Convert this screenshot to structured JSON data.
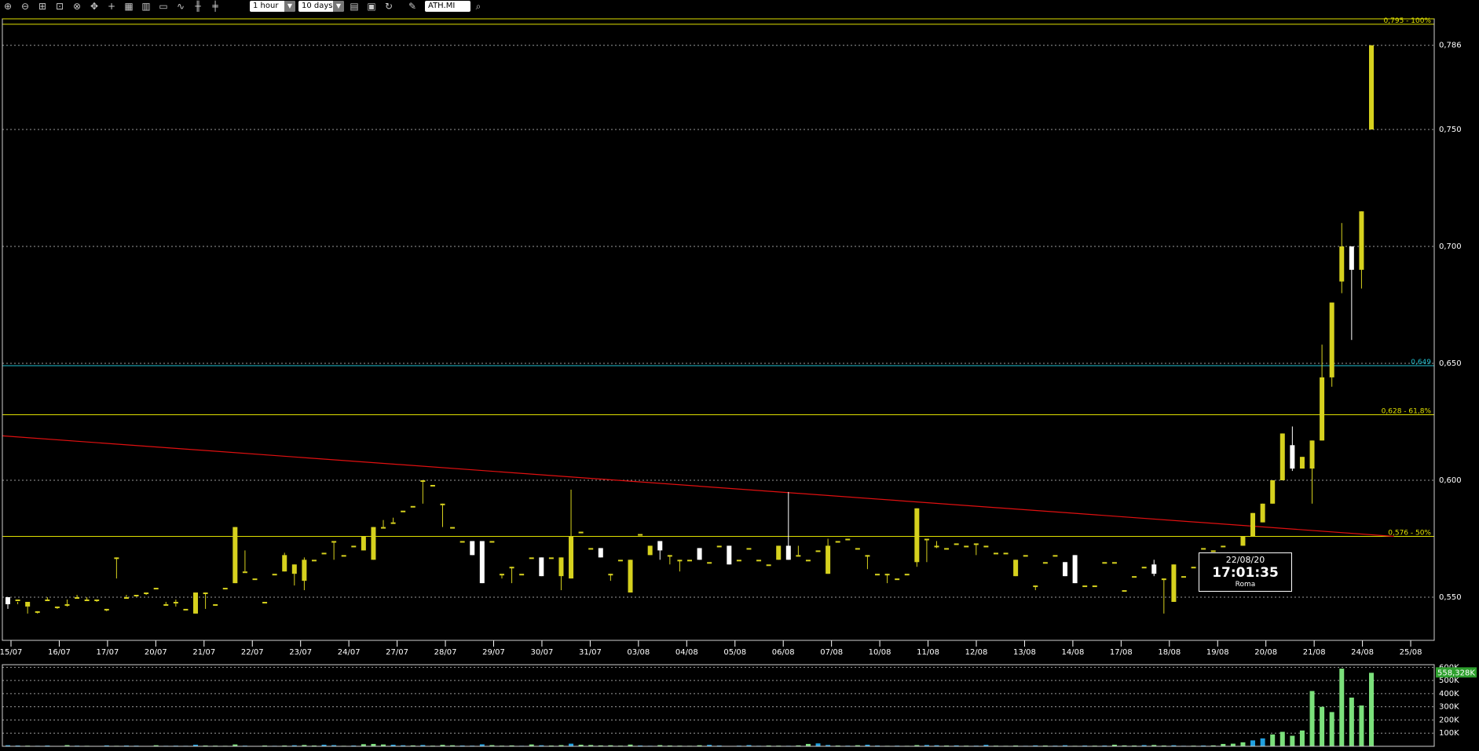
{
  "toolbar": {
    "icons": [
      "zoom-in-icon",
      "zoom-out-icon",
      "zoom-fit-icon",
      "zoom-region-icon",
      "zoom-reset-icon",
      "move-icon",
      "crosshair-icon",
      "table-view-icon",
      "grid-icon",
      "window-icon",
      "line-chart-icon",
      "candle-chart-icon",
      "bar-chart-icon"
    ],
    "timeframe": "1 hour",
    "period": "10 days",
    "symbol": "ATH.MI"
  },
  "colors": {
    "up": "#d6d11e",
    "down": "#ffffff",
    "fib": "#e0e000",
    "cyan": "#20c0d0",
    "trend": "#e01010",
    "grid": "#9a9a9a",
    "volume_up": "#7be07b",
    "volume_down": "#20a0e0"
  },
  "chart_data": [
    {
      "type": "candlestick",
      "timeframe": "1 hour",
      "ylim": [
        0.535,
        0.797
      ],
      "y_ticks": [
        "0,550",
        "0,600",
        "0,650",
        "0,700",
        "0,750",
        "0,786"
      ],
      "x_ticks": [
        "15/07",
        "16/07",
        "17/07",
        "20/07",
        "21/07",
        "22/07",
        "23/07",
        "24/07",
        "27/07",
        "28/07",
        "29/07",
        "30/07",
        "31/07",
        "03/08",
        "04/08",
        "05/08",
        "06/08",
        "07/08",
        "10/08",
        "11/08",
        "12/08",
        "13/08",
        "14/08",
        "17/08",
        "18/08",
        "19/08",
        "20/08",
        "21/08",
        "24/08",
        "25/08"
      ],
      "annotations": [
        {
          "label": "0,795 - 100%",
          "value": 0.795,
          "color": "#e0e000"
        },
        {
          "label": "0,649",
          "value": 0.649,
          "color": "#20c0d0"
        },
        {
          "label": "0,628 - 61,8%",
          "value": 0.628,
          "color": "#e0e000"
        },
        {
          "label": "0,576 - 50%",
          "value": 0.576,
          "color": "#e0e000"
        }
      ],
      "trendline": {
        "from": [
          "15/07",
          0.619
        ],
        "to": [
          "24/08",
          0.576
        ]
      },
      "candles": [
        [
          0.55,
          0.547,
          0.549,
          0.545
        ],
        [
          0.549,
          0.549,
          0.547,
          0.548
        ],
        [
          0.546,
          0.548,
          0.546,
          0.543
        ],
        [
          0.544,
          0.544,
          0.544,
          0.543
        ],
        [
          0.549,
          0.549,
          0.55,
          0.549
        ],
        [
          0.546,
          0.546,
          0.546,
          0.545
        ],
        [
          0.547,
          0.547,
          0.549,
          0.546
        ],
        [
          0.55,
          0.55,
          0.551,
          0.55
        ],
        [
          0.549,
          0.549,
          0.55,
          0.549
        ],
        [
          0.549,
          0.549,
          0.549,
          0.548
        ],
        [
          0.545,
          0.545,
          0.545,
          0.544
        ],
        [
          0.567,
          0.567,
          0.567,
          0.558
        ],
        [
          0.55,
          0.55,
          0.551,
          0.55
        ],
        [
          0.551,
          0.551,
          0.551,
          0.551
        ],
        [
          0.552,
          0.552,
          0.552,
          0.551
        ],
        [
          0.554,
          0.554,
          0.554,
          0.554
        ],
        [
          0.547,
          0.547,
          0.548,
          0.547
        ],
        [
          0.548,
          0.548,
          0.549,
          0.546
        ],
        [
          0.545,
          0.545,
          0.545,
          0.545
        ],
        [
          0.543,
          0.552,
          0.552,
          0.543
        ],
        [
          0.552,
          0.552,
          0.552,
          0.545
        ],
        [
          0.547,
          0.547,
          0.547,
          0.547
        ],
        [
          0.554,
          0.554,
          0.554,
          0.554
        ],
        [
          0.556,
          0.58,
          0.58,
          0.556
        ],
        [
          0.561,
          0.561,
          0.57,
          0.561
        ],
        [
          0.558,
          0.558,
          0.558,
          0.558
        ],
        [
          0.548,
          0.548,
          0.548,
          0.548
        ],
        [
          0.56,
          0.56,
          0.56,
          0.56
        ],
        [
          0.561,
          0.568,
          0.569,
          0.561
        ],
        [
          0.56,
          0.564,
          0.564,
          0.555
        ],
        [
          0.557,
          0.566,
          0.567,
          0.553
        ],
        [
          0.566,
          0.566,
          0.566,
          0.566
        ],
        [
          0.569,
          0.569,
          0.569,
          0.569
        ],
        [
          0.574,
          0.574,
          0.574,
          0.566
        ],
        [
          0.568,
          0.568,
          0.568,
          0.568
        ],
        [
          0.572,
          0.572,
          0.572,
          0.572
        ],
        [
          0.57,
          0.576,
          0.576,
          0.57
        ],
        [
          0.566,
          0.58,
          0.58,
          0.566
        ],
        [
          0.58,
          0.58,
          0.583,
          0.58
        ],
        [
          0.582,
          0.582,
          0.584,
          0.582
        ],
        [
          0.587,
          0.587,
          0.587,
          0.587
        ],
        [
          0.589,
          0.589,
          0.589,
          0.589
        ],
        [
          0.6,
          0.6,
          0.6,
          0.59
        ],
        [
          0.598,
          0.598,
          0.598,
          0.598
        ],
        [
          0.59,
          0.59,
          0.59,
          0.58
        ],
        [
          0.58,
          0.58,
          0.58,
          0.58
        ],
        [
          0.574,
          0.574,
          0.574,
          0.574
        ],
        [
          0.574,
          0.568,
          0.574,
          0.568
        ],
        [
          0.574,
          0.556,
          0.574,
          0.556
        ],
        [
          0.574,
          0.574,
          0.574,
          0.574
        ],
        [
          0.56,
          0.56,
          0.56,
          0.558
        ],
        [
          0.563,
          0.563,
          0.563,
          0.556
        ],
        [
          0.56,
          0.56,
          0.56,
          0.56
        ],
        [
          0.567,
          0.567,
          0.567,
          0.567
        ],
        [
          0.567,
          0.559,
          0.567,
          0.559
        ],
        [
          0.567,
          0.567,
          0.567,
          0.567
        ],
        [
          0.559,
          0.567,
          0.567,
          0.553
        ],
        [
          0.558,
          0.576,
          0.596,
          0.558
        ],
        [
          0.578,
          0.578,
          0.578,
          0.578
        ],
        [
          0.571,
          0.571,
          0.571,
          0.571
        ],
        [
          0.571,
          0.567,
          0.571,
          0.567
        ],
        [
          0.56,
          0.56,
          0.56,
          0.557
        ],
        [
          0.566,
          0.566,
          0.566,
          0.566
        ],
        [
          0.552,
          0.566,
          0.566,
          0.552
        ],
        [
          0.577,
          0.577,
          0.577,
          0.577
        ],
        [
          0.568,
          0.572,
          0.572,
          0.568
        ],
        [
          0.574,
          0.57,
          0.574,
          0.566
        ],
        [
          0.568,
          0.568,
          0.568,
          0.564
        ],
        [
          0.566,
          0.566,
          0.566,
          0.561
        ],
        [
          0.566,
          0.566,
          0.566,
          0.566
        ],
        [
          0.571,
          0.566,
          0.571,
          0.566
        ],
        [
          0.565,
          0.565,
          0.565,
          0.565
        ],
        [
          0.572,
          0.572,
          0.572,
          0.572
        ],
        [
          0.572,
          0.564,
          0.572,
          0.564
        ],
        [
          0.566,
          0.566,
          0.566,
          0.566
        ],
        [
          0.571,
          0.571,
          0.571,
          0.571
        ],
        [
          0.566,
          0.566,
          0.566,
          0.566
        ],
        [
          0.564,
          0.564,
          0.564,
          0.564
        ],
        [
          0.566,
          0.572,
          0.572,
          0.566
        ],
        [
          0.572,
          0.566,
          0.595,
          0.566
        ],
        [
          0.568,
          0.568,
          0.572,
          0.568
        ],
        [
          0.566,
          0.566,
          0.566,
          0.566
        ],
        [
          0.57,
          0.57,
          0.57,
          0.57
        ],
        [
          0.56,
          0.572,
          0.575,
          0.56
        ],
        [
          0.574,
          0.574,
          0.574,
          0.574
        ],
        [
          0.575,
          0.575,
          0.575,
          0.575
        ],
        [
          0.571,
          0.571,
          0.571,
          0.571
        ],
        [
          0.568,
          0.568,
          0.568,
          0.562
        ],
        [
          0.56,
          0.56,
          0.56,
          0.56
        ],
        [
          0.56,
          0.56,
          0.56,
          0.556
        ],
        [
          0.558,
          0.558,
          0.558,
          0.558
        ],
        [
          0.56,
          0.56,
          0.56,
          0.56
        ],
        [
          0.565,
          0.588,
          0.588,
          0.563
        ],
        [
          0.575,
          0.575,
          0.575,
          0.565
        ],
        [
          0.572,
          0.572,
          0.574,
          0.571
        ],
        [
          0.571,
          0.571,
          0.571,
          0.571
        ],
        [
          0.573,
          0.573,
          0.573,
          0.573
        ],
        [
          0.572,
          0.572,
          0.572,
          0.572
        ],
        [
          0.573,
          0.573,
          0.573,
          0.568
        ],
        [
          0.572,
          0.572,
          0.572,
          0.572
        ],
        [
          0.569,
          0.569,
          0.569,
          0.569
        ],
        [
          0.569,
          0.569,
          0.569,
          0.569
        ],
        [
          0.559,
          0.566,
          0.566,
          0.559
        ],
        [
          0.568,
          0.568,
          0.568,
          0.568
        ],
        [
          0.555,
          0.555,
          0.555,
          0.553
        ],
        [
          0.565,
          0.565,
          0.565,
          0.565
        ],
        [
          0.568,
          0.568,
          0.568,
          0.568
        ],
        [
          0.565,
          0.559,
          0.565,
          0.559
        ],
        [
          0.568,
          0.556,
          0.568,
          0.556
        ],
        [
          0.555,
          0.555,
          0.555,
          0.555
        ],
        [
          0.555,
          0.555,
          0.555,
          0.555
        ],
        [
          0.565,
          0.565,
          0.565,
          0.565
        ],
        [
          0.565,
          0.565,
          0.565,
          0.565
        ],
        [
          0.553,
          0.553,
          0.553,
          0.553
        ],
        [
          0.559,
          0.559,
          0.559,
          0.559
        ],
        [
          0.563,
          0.563,
          0.563,
          0.563
        ],
        [
          0.564,
          0.56,
          0.566,
          0.559
        ],
        [
          0.558,
          0.558,
          0.558,
          0.543
        ],
        [
          0.548,
          0.564,
          0.564,
          0.548
        ],
        [
          0.559,
          0.559,
          0.559,
          0.559
        ],
        [
          0.563,
          0.563,
          0.563,
          0.563
        ],
        [
          0.571,
          0.571,
          0.571,
          0.571
        ],
        [
          0.57,
          0.57,
          0.57,
          0.57
        ],
        [
          0.572,
          0.572,
          0.572,
          0.572
        ],
        [
          0.569,
          0.569,
          0.569,
          0.569
        ],
        [
          0.572,
          0.576,
          0.576,
          0.572
        ],
        [
          0.576,
          0.586,
          0.586,
          0.576
        ],
        [
          0.582,
          0.59,
          0.59,
          0.582
        ],
        [
          0.59,
          0.6,
          0.6,
          0.59
        ],
        [
          0.6,
          0.62,
          0.62,
          0.6
        ],
        [
          0.615,
          0.605,
          0.623,
          0.604
        ],
        [
          0.605,
          0.61,
          0.61,
          0.605
        ],
        [
          0.605,
          0.617,
          0.617,
          0.59
        ],
        [
          0.617,
          0.644,
          0.658,
          0.617
        ],
        [
          0.644,
          0.676,
          0.676,
          0.64
        ],
        [
          0.685,
          0.7,
          0.71,
          0.68
        ],
        [
          0.7,
          0.69,
          0.7,
          0.66
        ],
        [
          0.69,
          0.715,
          0.715,
          0.682
        ],
        [
          0.75,
          0.786,
          0.786,
          0.75
        ]
      ]
    },
    {
      "type": "bar",
      "title": "",
      "y_ticks": [
        "100K",
        "200K",
        "300K",
        "400K",
        "500K",
        "600K"
      ],
      "last_value_label": "558,328K",
      "ylim": [
        0,
        620000
      ],
      "values": [
        8000,
        6000,
        5000,
        4000,
        6000,
        3000,
        9000,
        5000,
        4000,
        3000,
        7000,
        4000,
        6000,
        5000,
        3000,
        8000,
        4000,
        5000,
        4000,
        12000,
        6000,
        5000,
        4000,
        14000,
        5000,
        3000,
        6000,
        4000,
        6000,
        8000,
        10000,
        6000,
        12000,
        9000,
        4000,
        6000,
        16000,
        18000,
        14000,
        12000,
        8000,
        7000,
        10000,
        5000,
        11000,
        8000,
        6000,
        5000,
        15000,
        9000,
        5000,
        7000,
        4000,
        14000,
        8000,
        6000,
        9000,
        20000,
        12000,
        10000,
        7000,
        8000,
        5000,
        13000,
        6000,
        4000,
        9000,
        6000,
        5000,
        4000,
        8000,
        11000,
        6000,
        3000,
        5000,
        9000,
        4000,
        6000,
        5000,
        4000,
        7000,
        18000,
        22000,
        10000,
        6000,
        5000,
        8000,
        12000,
        6000,
        4000,
        5000,
        4000,
        9000,
        10000,
        8000,
        6000,
        7000,
        5000,
        5000,
        11000,
        5000,
        4000,
        6000,
        4000,
        7000,
        6000,
        5000,
        8000,
        4000,
        6000,
        5000,
        6000,
        12000,
        7000,
        6000,
        9000,
        10000,
        6000,
        8000,
        4000,
        5000,
        6000,
        7000,
        18000,
        20000,
        30000,
        45000,
        60000,
        90000,
        110000,
        80000,
        120000,
        420000,
        300000,
        260000,
        590000,
        370000,
        310000,
        558328
      ],
      "colors": [
        "dn",
        "dn",
        "up",
        "dn",
        "dn",
        "dn",
        "up",
        "dn",
        "up",
        "dn",
        "dn",
        "up",
        "dn",
        "dn",
        "up",
        "up",
        "dn",
        "dn",
        "dn",
        "dn",
        "up",
        "up",
        "up",
        "up",
        "dn",
        "dn",
        "up",
        "dn",
        "up",
        "dn",
        "up",
        "up",
        "dn",
        "dn",
        "up",
        "dn",
        "up",
        "up",
        "up",
        "dn",
        "dn",
        "up",
        "dn",
        "up",
        "up",
        "up",
        "dn",
        "dn",
        "dn",
        "up",
        "up",
        "up",
        "dn",
        "up",
        "dn",
        "up",
        "up",
        "dn",
        "up",
        "up",
        "up",
        "up",
        "up",
        "up",
        "dn",
        "dn",
        "up",
        "up",
        "up",
        "up",
        "up",
        "dn",
        "dn",
        "up",
        "dn",
        "dn",
        "dn",
        "up",
        "up",
        "dn",
        "up",
        "up",
        "dn",
        "dn",
        "up",
        "dn",
        "up",
        "dn",
        "dn",
        "up",
        "dn",
        "up",
        "up",
        "dn",
        "dn",
        "up",
        "dn",
        "up",
        "dn",
        "dn",
        "up",
        "up",
        "up",
        "dn",
        "dn",
        "up",
        "dn",
        "dn",
        "up",
        "dn",
        "up",
        "dn",
        "up",
        "up",
        "up",
        "dn",
        "up",
        "up",
        "dn",
        "dn",
        "up",
        "dn",
        "up",
        "up",
        "up",
        "up",
        "dn",
        "dn",
        "up",
        "up",
        "up",
        "up",
        "up",
        "up",
        "up",
        "up",
        "up",
        "up",
        "up",
        "up",
        "up"
      ]
    }
  ],
  "clock": {
    "date": "22/08/20",
    "time": "17:01:35",
    "zone": "Roma"
  }
}
